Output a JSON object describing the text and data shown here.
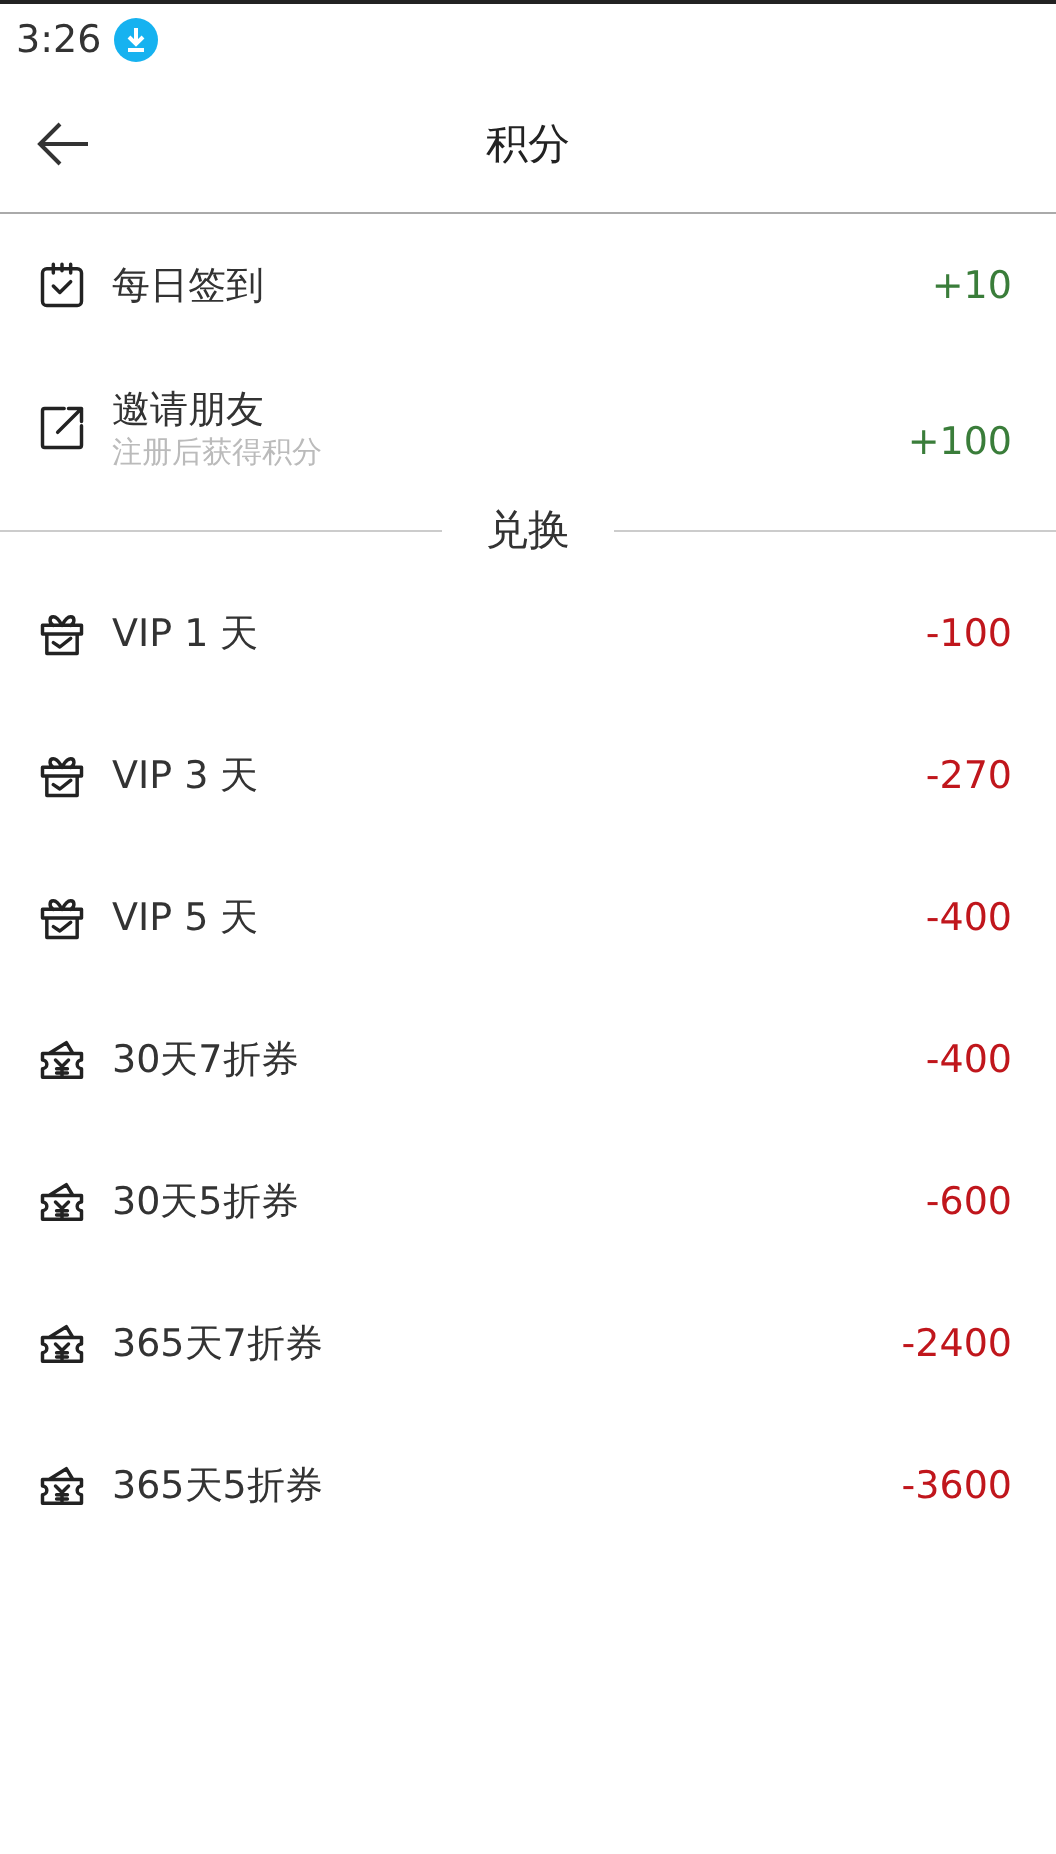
{
  "status_bar": {
    "time": "3:26"
  },
  "header": {
    "title": "积分"
  },
  "earn": [
    {
      "kind": "checkin",
      "label": "每日签到",
      "points": "+10"
    },
    {
      "kind": "invite",
      "label": "邀请朋友",
      "subtitle": "注册后获得积分",
      "points": "+100"
    }
  ],
  "exchange": {
    "heading": "兑换",
    "items": [
      {
        "kind": "vip",
        "label": "VIP 1 天",
        "points": "-100"
      },
      {
        "kind": "vip",
        "label": "VIP 3 天",
        "points": "-270"
      },
      {
        "kind": "vip",
        "label": "VIP 5 天",
        "points": "-400"
      },
      {
        "kind": "coupon",
        "label": "30天7折券",
        "points": "-400"
      },
      {
        "kind": "coupon",
        "label": "30天5折券",
        "points": "-600"
      },
      {
        "kind": "coupon",
        "label": "365天7折券",
        "points": "-2400"
      },
      {
        "kind": "coupon",
        "label": "365天5折券",
        "points": "-3600"
      }
    ]
  }
}
